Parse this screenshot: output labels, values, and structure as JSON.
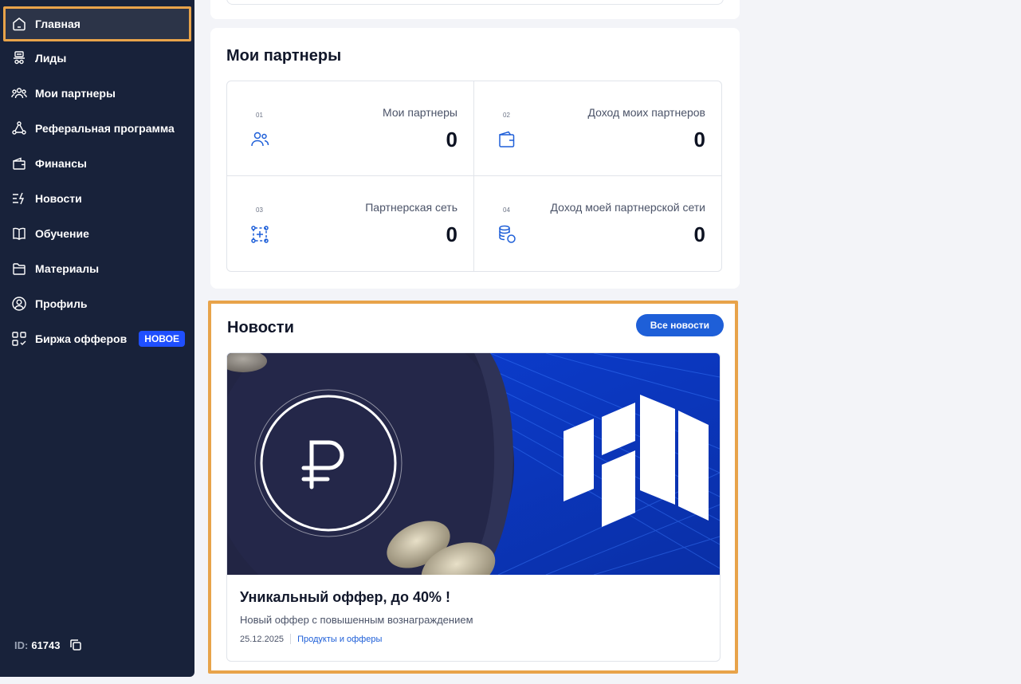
{
  "sidebar": {
    "items": [
      {
        "label": "Главная",
        "icon": "home-icon",
        "active": true
      },
      {
        "label": "Лиды",
        "icon": "leads-icon"
      },
      {
        "label": "Мои партнеры",
        "icon": "partners-icon"
      },
      {
        "label": "Реферальная программа",
        "icon": "referral-icon"
      },
      {
        "label": "Финансы",
        "icon": "wallet-icon"
      },
      {
        "label": "Новости",
        "icon": "news-icon"
      },
      {
        "label": "Обучение",
        "icon": "book-icon"
      },
      {
        "label": "Материалы",
        "icon": "folder-icon"
      },
      {
        "label": "Профиль",
        "icon": "profile-icon"
      },
      {
        "label": "Биржа офферов",
        "icon": "offers-icon",
        "badge": "НОВОЕ"
      }
    ],
    "id_label": "ID:",
    "id_value": "61743"
  },
  "partners": {
    "title": "Мои партнеры",
    "stats": [
      {
        "num": "01",
        "label": "Мои партнеры",
        "value": "0",
        "icon": "partners-icon"
      },
      {
        "num": "02",
        "label": "Доход моих партнеров",
        "value": "0",
        "icon": "wallet-icon"
      },
      {
        "num": "03",
        "label": "Партнерская сеть",
        "value": "0",
        "icon": "network-add-icon"
      },
      {
        "num": "04",
        "label": "Доход моей партнерской сети",
        "value": "0",
        "icon": "coins-icon"
      }
    ]
  },
  "news": {
    "title": "Новости",
    "all_button": "Все новости",
    "item": {
      "title": "Уникальный оффер, до 40% !",
      "description": "Новый оффер с повышенным вознаграждением",
      "date": "25.12.2025",
      "category": "Продукты и офферы"
    }
  },
  "colors": {
    "sidebar_bg": "#18223a",
    "highlight": "#e8a34a",
    "accent": "#1e5fd8",
    "badge": "#1f4fff"
  }
}
